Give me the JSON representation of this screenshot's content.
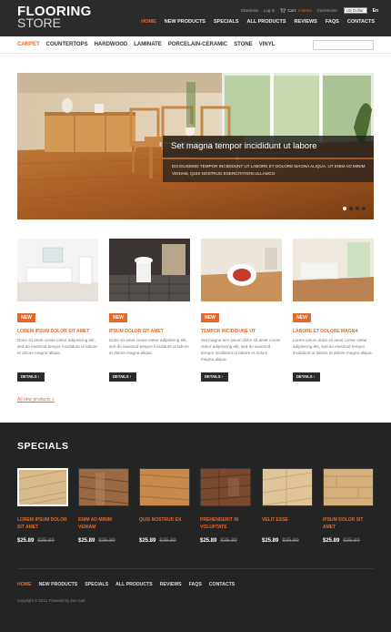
{
  "header": {
    "logo_line1": "FLOORING",
    "logo_line2": "STORE",
    "checkout": "Checkout",
    "login": "Log In",
    "cart_label": "Cart:",
    "cart_count": "0 items",
    "currencies_label": "Currencies:",
    "currency_value": "US Dollar",
    "language": "En",
    "nav": [
      "HOME",
      "NEW PRODUCTS",
      "SPECIALS",
      "ALL PRODUCTS",
      "REVIEWS",
      "FAQS",
      "CONTACTS"
    ],
    "nav_active": "HOME"
  },
  "categories": [
    "CARPET",
    "COUNTERTOPS",
    "HARDWOOD",
    "LAMINATE",
    "PORCELAIN-CERAMIC",
    "STONE",
    "VINYL"
  ],
  "slider": {
    "title": "Set magna tempor incididunt ut labore",
    "text": "DO EIUSMOD TEMPOR INCIDIDUNT UT LABORE ET DOLORE MAGNA ALIQUA. UT ENIM AD MINIM VENIAM, QUIS NOSTRUD EXERCITATION ULLAMCO",
    "dots": 4,
    "active_dot": 0
  },
  "products": [
    {
      "badge": "NEW",
      "title": "LOREM IPSUM DOLOR SIT AMET",
      "desc": "Dolor sit amet conse ctetur adipisicing elit, sed do eiusmod tempor incididunt ut labore et dolore magna aliqua.",
      "button": "DETAILS"
    },
    {
      "badge": "NEW",
      "title": "IPSUM DOLOR SIT AMET",
      "desc": "Dolor sit amet conse ctetur adipisicing elit, sed do eiusmod tempor incididunt ut labore et dolore magna aliqua.",
      "button": "DETAILS"
    },
    {
      "badge": "NEW",
      "title": "TEMPOR INCIDIDUNE UT",
      "desc": "Set magna tem ipsum dolor sit amet conse ctetur adipisicing elit, sed do eiusmod tempor incididunt ut labore et dolore magna aliqua.",
      "button": "DETAILS"
    },
    {
      "badge": "NEW",
      "title": "LABORE ET DOLORE MAGNA",
      "desc": "Lorem ipsum dolor sit amet conse ctetur adipisicing elit, sed do eiusmod tempor incididunt ut labore et dolore magna aliqua.",
      "button": "DETAILS"
    }
  ],
  "all_new_link": "All new products »",
  "specials": {
    "heading": "SPECIALS",
    "items": [
      {
        "name": "LOREM IPSUM DOLOR SIT AMET",
        "price": "$25.89",
        "old_price": "$35.89"
      },
      {
        "name": "ENIM AD MINIM VENIAM",
        "price": "$25.89",
        "old_price": "$35.89"
      },
      {
        "name": "QUIS NOSTRUD EX",
        "price": "$25.89",
        "old_price": "$35.89"
      },
      {
        "name": "PREHENDERIT IN VOLUPTATE",
        "price": "$25.89",
        "old_price": "$35.89"
      },
      {
        "name": "VELIT ESSE",
        "price": "$25.89",
        "old_price": "$35.89"
      },
      {
        "name": "IPSUM DOLOR SIT AMET",
        "price": "$25.89",
        "old_price": "$35.89"
      }
    ]
  },
  "footer": {
    "nav": [
      "HOME",
      "NEW PRODUCTS",
      "SPECIALS",
      "ALL PRODUCTS",
      "REVIEWS",
      "FAQS",
      "CONTACTS"
    ],
    "nav_active": "HOME",
    "copyright": "Copyright © 2012. Powered by Zen Cart"
  },
  "colors": {
    "accent": "#e36a2c",
    "dark": "#242424",
    "header": "#2b2b2b"
  }
}
